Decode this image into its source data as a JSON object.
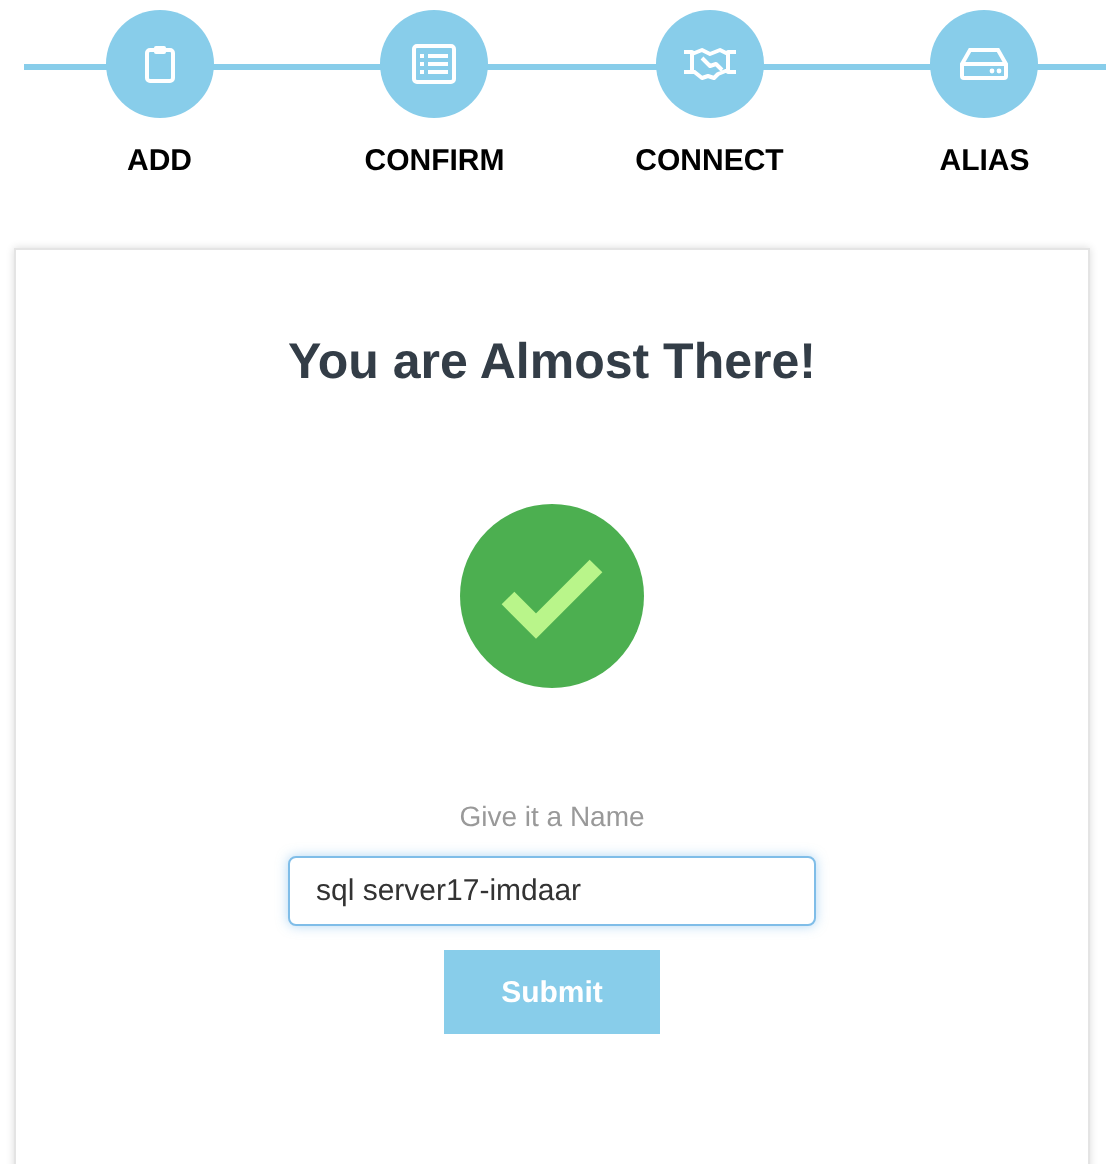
{
  "steps": [
    {
      "label": "ADD",
      "kind": "clipboard"
    },
    {
      "label": "CONFIRM",
      "kind": "list"
    },
    {
      "label": "CONNECT",
      "kind": "handshake"
    },
    {
      "label": "ALIAS",
      "kind": "drive"
    }
  ],
  "card": {
    "title": "You are Almost There!",
    "field_label": "Give it a Name",
    "name_field": {
      "value": "sql server17-imdaar"
    },
    "submit": "Submit"
  }
}
